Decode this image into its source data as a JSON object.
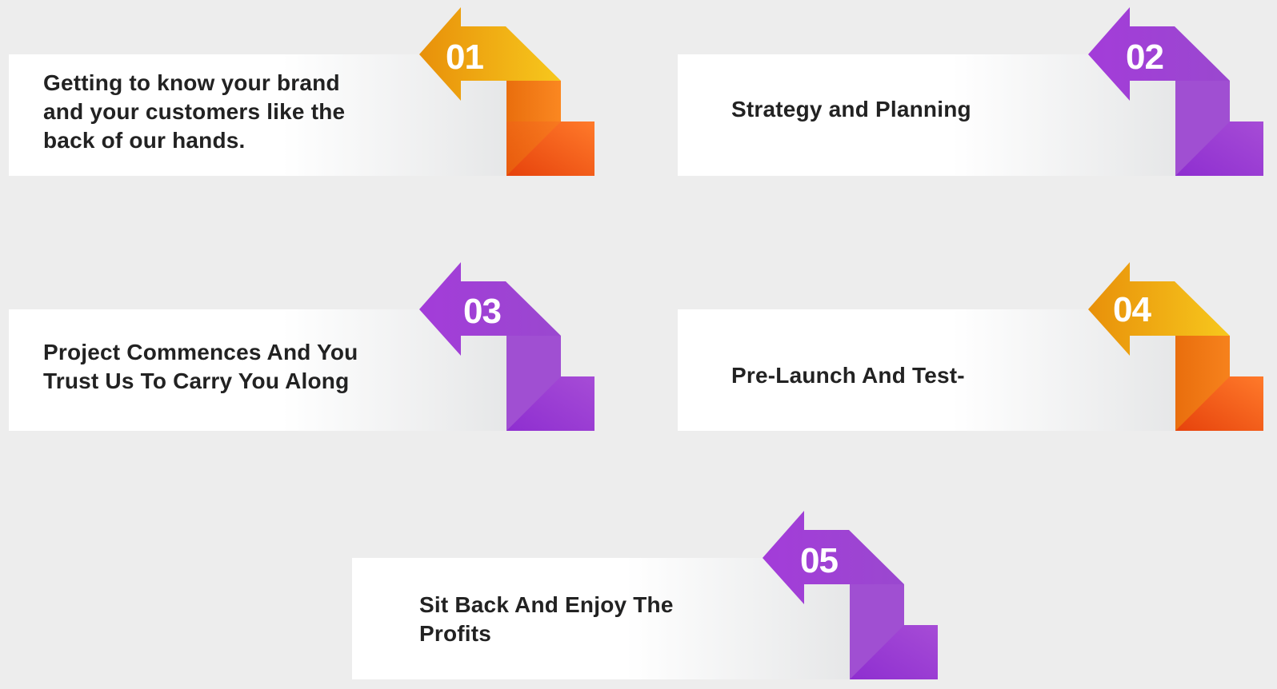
{
  "steps": [
    {
      "number": "01",
      "text": "Getting to know your brand\nand your customers like the\nback of our hands.",
      "color": "orange"
    },
    {
      "number": "02",
      "text": "Strategy and Planning",
      "color": "purple"
    },
    {
      "number": "03",
      "text": "Project Commences And You\nTrust Us To Carry You Along",
      "color": "purple"
    },
    {
      "number": "04",
      "text": "Pre-Launch And Test-",
      "color": "orange"
    },
    {
      "number": "05",
      "text": "Sit Back And Enjoy The\nProfits",
      "color": "purple"
    }
  ],
  "palette": {
    "orange": {
      "arrow_start": "#e8900a",
      "arrow_end": "#f7c81d",
      "fold_start": "#f08a10",
      "fold_end": "#ff6a1f",
      "fold_dark": "#e9470e"
    },
    "purple": {
      "arrow_start": "#a23ed8",
      "arrow_end": "#9b47d0",
      "fold_start": "#a04fd2",
      "fold_end": "#9a3fcf",
      "fold_dark": "#8f2fd0"
    }
  }
}
